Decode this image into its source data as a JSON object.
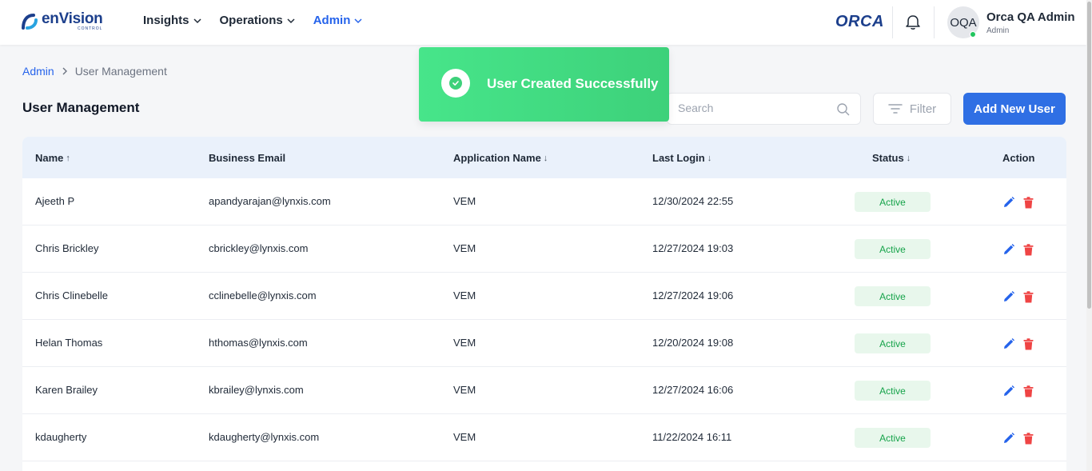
{
  "brand": {
    "name": "enVision",
    "sub": "CONTROL",
    "partner": "ORCA"
  },
  "nav": [
    {
      "label": "Insights",
      "active": false
    },
    {
      "label": "Operations",
      "active": false
    },
    {
      "label": "Admin",
      "active": true
    }
  ],
  "user": {
    "initials": "OQA",
    "name": "Orca QA Admin",
    "role": "Admin",
    "online": true
  },
  "breadcrumb": {
    "parent": "Admin",
    "separator": ">",
    "current": "User Management"
  },
  "page": {
    "title": "User Management"
  },
  "toolbar": {
    "search_placeholder": "Search",
    "filter_label": "Filter",
    "add_label": "Add New User"
  },
  "toast": {
    "message": "User Created Successfully"
  },
  "table": {
    "columns": [
      {
        "label": "Name",
        "sort": "↑"
      },
      {
        "label": "Business Email",
        "sort": ""
      },
      {
        "label": "Application Name",
        "sort": "↓"
      },
      {
        "label": "Last Login",
        "sort": "↓"
      },
      {
        "label": "Status",
        "sort": "↓"
      },
      {
        "label": "Action",
        "sort": ""
      }
    ],
    "rows": [
      {
        "name": "Ajeeth P",
        "email": "apandyarajan@lynxis.com",
        "app": "VEM",
        "last_login": "12/30/2024 22:55",
        "status": "Active"
      },
      {
        "name": "Chris Brickley",
        "email": "cbrickley@lynxis.com",
        "app": "VEM",
        "last_login": "12/27/2024 19:03",
        "status": "Active"
      },
      {
        "name": "Chris Clinebelle",
        "email": "cclinebelle@lynxis.com",
        "app": "VEM",
        "last_login": "12/27/2024 19:06",
        "status": "Active"
      },
      {
        "name": "Helan Thomas",
        "email": "hthomas@lynxis.com",
        "app": "VEM",
        "last_login": "12/20/2024 19:08",
        "status": "Active"
      },
      {
        "name": "Karen Brailey",
        "email": "kbrailey@lynxis.com",
        "app": "VEM",
        "last_login": "12/27/2024 16:06",
        "status": "Active"
      },
      {
        "name": "kdaugherty",
        "email": "kdaugherty@lynxis.com",
        "app": "VEM",
        "last_login": "11/22/2024 16:11",
        "status": "Active"
      }
    ]
  },
  "colors": {
    "accent": "#2563eb",
    "primary_button": "#2f6fe4",
    "toast": "#47e58a",
    "active_badge_bg": "#e8f7ec",
    "active_badge_text": "#16a34a",
    "delete": "#ef4444"
  },
  "icons": {
    "edit": "pencil-icon",
    "delete": "trash-icon",
    "search": "search-icon",
    "filter": "filter-icon",
    "bell": "bell-icon",
    "success": "check-circle-icon"
  }
}
